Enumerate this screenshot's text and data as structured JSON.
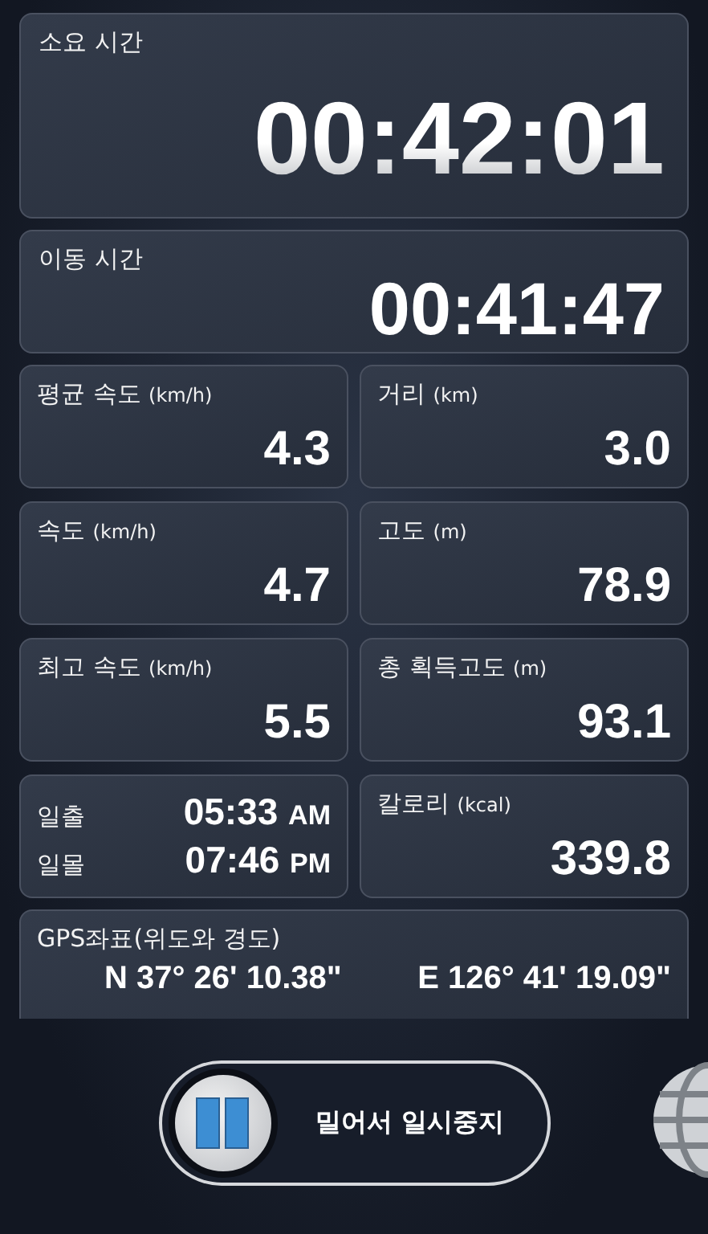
{
  "timers": [
    {
      "label": "소요 시간",
      "value": "00:42:01",
      "kind": "large"
    },
    {
      "label": "이동 시간",
      "value": "00:41:47",
      "kind": "medium"
    }
  ],
  "stats": [
    {
      "kind": "stat",
      "label": "평균 속도",
      "unit": "(km/h)",
      "value": "4.3"
    },
    {
      "kind": "stat",
      "label": "거리",
      "unit": "(km)",
      "value": "3.0"
    },
    {
      "kind": "stat",
      "label": "속도",
      "unit": "(km/h)",
      "value": "4.7"
    },
    {
      "kind": "stat",
      "label": "고도",
      "unit": "(m)",
      "value": "78.9"
    },
    {
      "kind": "stat",
      "label": "최고 속도",
      "unit": "(km/h)",
      "value": "5.5"
    },
    {
      "kind": "stat",
      "label": "총 획득고도",
      "unit": "(m)",
      "value": "93.1"
    },
    {
      "kind": "sun",
      "rows": [
        {
          "label": "일출",
          "time": "05:33",
          "suffix": "AM"
        },
        {
          "label": "일몰",
          "time": "07:46",
          "suffix": "PM"
        }
      ]
    },
    {
      "kind": "stat",
      "label": "칼로리",
      "unit": "(kcal)",
      "value": "339.8"
    }
  ],
  "gps": {
    "label": "GPS좌표(위도와 경도)",
    "latitude": "N 37° 26' 10.38\"",
    "longitude": "E 126° 41' 19.09\""
  },
  "pause_slider": {
    "label": "밀어서 일시중지"
  }
}
